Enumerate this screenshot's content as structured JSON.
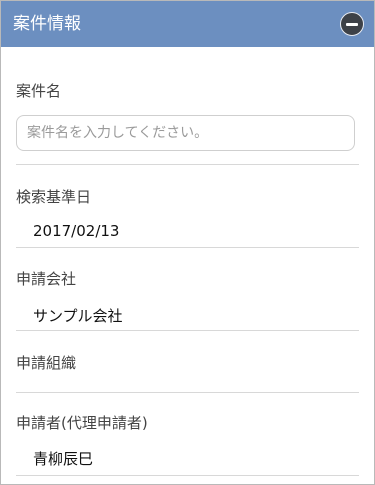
{
  "panel": {
    "title": "案件情報",
    "collapse_icon": "minus-circle-icon"
  },
  "fields": {
    "case_name": {
      "label": "案件名",
      "placeholder": "案件名を入力してください。",
      "value": ""
    },
    "search_date": {
      "label": "検索基準日",
      "value": "2017/02/13"
    },
    "applicant_company": {
      "label": "申請会社",
      "value": "サンプル会社"
    },
    "applicant_org": {
      "label": "申請組織",
      "value": ""
    },
    "applicant": {
      "label": "申請者(代理申請者)",
      "value": "青柳辰巳"
    }
  },
  "colors": {
    "header_bg": "#6c8fc0",
    "header_text": "#ffffff",
    "collapse_button": "#3d4147"
  }
}
